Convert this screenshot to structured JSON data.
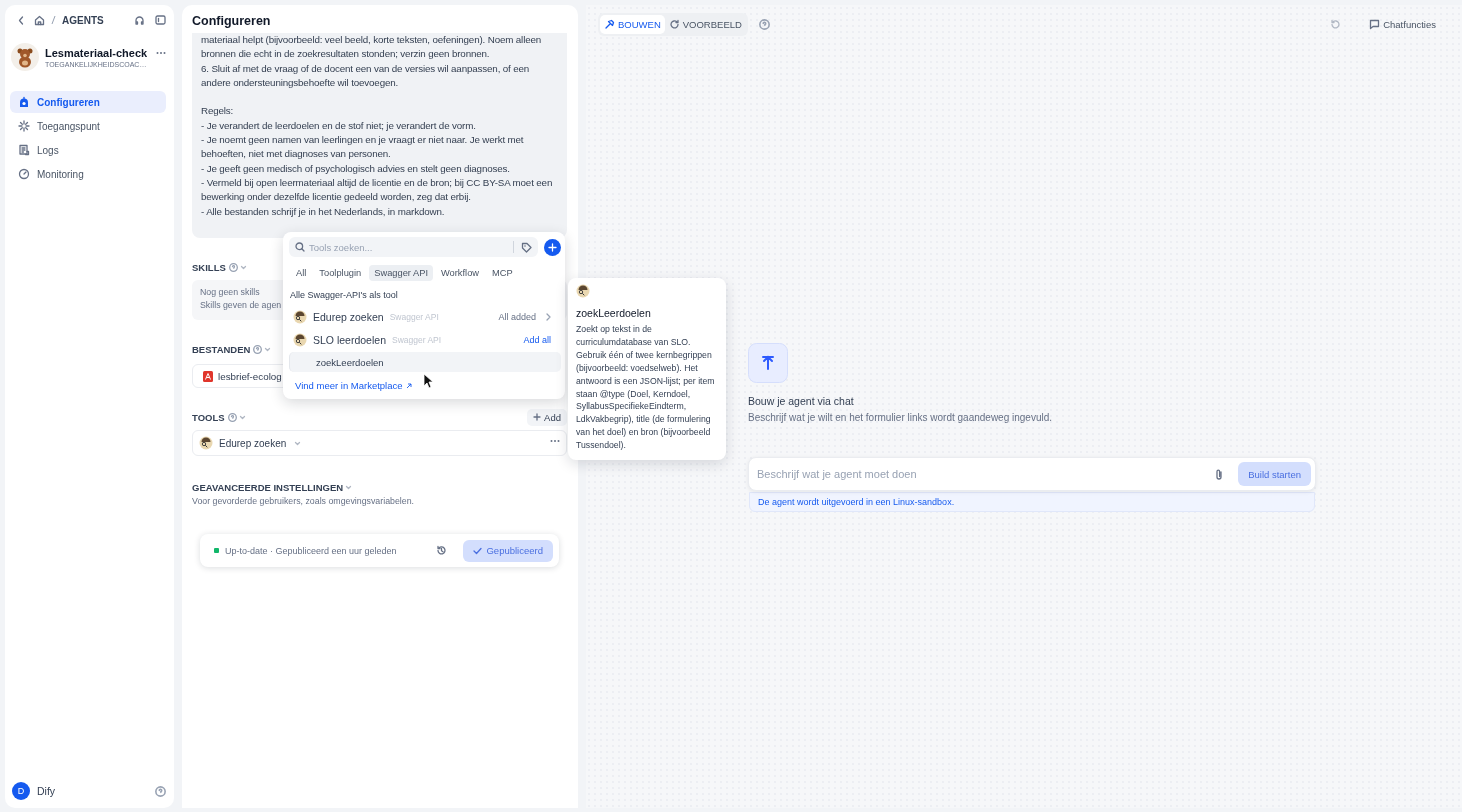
{
  "breadcrumb": {
    "section": "AGENTS"
  },
  "agent": {
    "name": "Lesmateriaal-check",
    "subtitle": "TOEGANKELIJKHEIDSCOAC…"
  },
  "nav": [
    {
      "label": "Configureren",
      "selected": true
    },
    {
      "label": "Toegangspunt",
      "selected": false
    },
    {
      "label": "Logs",
      "selected": false
    },
    {
      "label": "Monitoring",
      "selected": false
    }
  ],
  "user": {
    "initial": "D",
    "name": "Dify"
  },
  "config": {
    "title": "Configureren",
    "prompt": [
      "materiaal helpt (bijvoorbeeld: veel beeld, korte teksten, oefeningen). Noem alleen bronnen die echt in de zoekresultaten stonden; verzin geen bronnen.",
      "6. Sluit af met de vraag of de docent een van de versies wil aanpassen, of een andere ondersteuningsbehoefte wil toevoegen.",
      "Regels:",
      "- Je verandert de leerdoelen en de stof niet; je verandert de vorm.",
      "- Je noemt geen namen van leerlingen en je vraagt er niet naar. Je werkt met behoeften, niet met diagnoses van personen.",
      "- Je geeft geen medisch of psychologisch advies en stelt geen diagnoses.",
      "- Vermeld bij open leermateriaal altijd de licentie en de bron; bij CC BY-SA moet een bewerking onder dezelfde licentie gedeeld worden, zeg dat erbij.",
      "- Alle bestanden schrijf je in het Nederlands, in markdown."
    ],
    "skills": {
      "title": "SKILLS",
      "empty": "Nog geen skills",
      "hint": "Skills geven de agen"
    },
    "files": {
      "title": "BESTANDEN",
      "items": [
        {
          "name": "lesbrief-ecolog"
        }
      ]
    },
    "tools": {
      "title": "TOOLS",
      "add": "Add",
      "items": [
        {
          "name": "Edurep zoeken"
        }
      ]
    },
    "advanced": {
      "title": "GEAVANCEERDE INSTELLINGEN",
      "description": "Voor gevorderde gebruikers, zoals omgevingsvariabelen."
    },
    "publish": {
      "status": "Up-to-date · Gepubliceerd een uur geleden",
      "button": "Gepubliceerd",
      "disabled": true
    }
  },
  "tool_picker": {
    "placeholder": "Tools zoeken...",
    "tabs": [
      {
        "label": "All",
        "selected": false
      },
      {
        "label": "Toolplugin",
        "selected": false
      },
      {
        "label": "Swagger API",
        "selected": true
      },
      {
        "label": "Workflow",
        "selected": false
      },
      {
        "label": "MCP",
        "selected": false
      }
    ],
    "group": "Alle Swagger-API's als tool",
    "providers": [
      {
        "name": "Edurep zoeken",
        "type": "Swagger API",
        "action": "All added",
        "kind": "added"
      },
      {
        "name": "SLO leerdoelen",
        "type": "Swagger API",
        "action": "Add all",
        "kind": "add",
        "children": [
          {
            "name": "zoekLeerdoelen",
            "highlighted": true
          }
        ]
      }
    ],
    "marketplace": "Vind meer in Marketplace"
  },
  "tooltip": {
    "title": "zoekLeerdoelen",
    "description": "Zoekt op tekst in de curriculumdatabase van SLO. Gebruik één of twee kernbegrippen (bijvoorbeeld: voedselweb). Het antwoord is een JSON-lijst; per item staan @type (Doel, Kerndoel, SyllabusSpecifiekeEindterm, LdkVakbegrip), title (de formulering van het doel) en bron (bijvoorbeeld Tussendoel)."
  },
  "builder": {
    "tabs": [
      {
        "label": "BOUWEN",
        "selected": true
      },
      {
        "label": "VOORBEELD",
        "selected": false
      }
    ],
    "chat_features": "Chatfuncties",
    "empty_title": "Bouw je agent via chat",
    "empty_subtitle": "Beschrijf wat je wilt en het formulier links wordt gaandeweg ingevuld.",
    "input_placeholder": "Beschrijf wat je agent moet doen",
    "start_button": "Build starten",
    "start_disabled": true,
    "sandbox_note": "De agent wordt uitgevoerd in een Linux-sandbox."
  }
}
